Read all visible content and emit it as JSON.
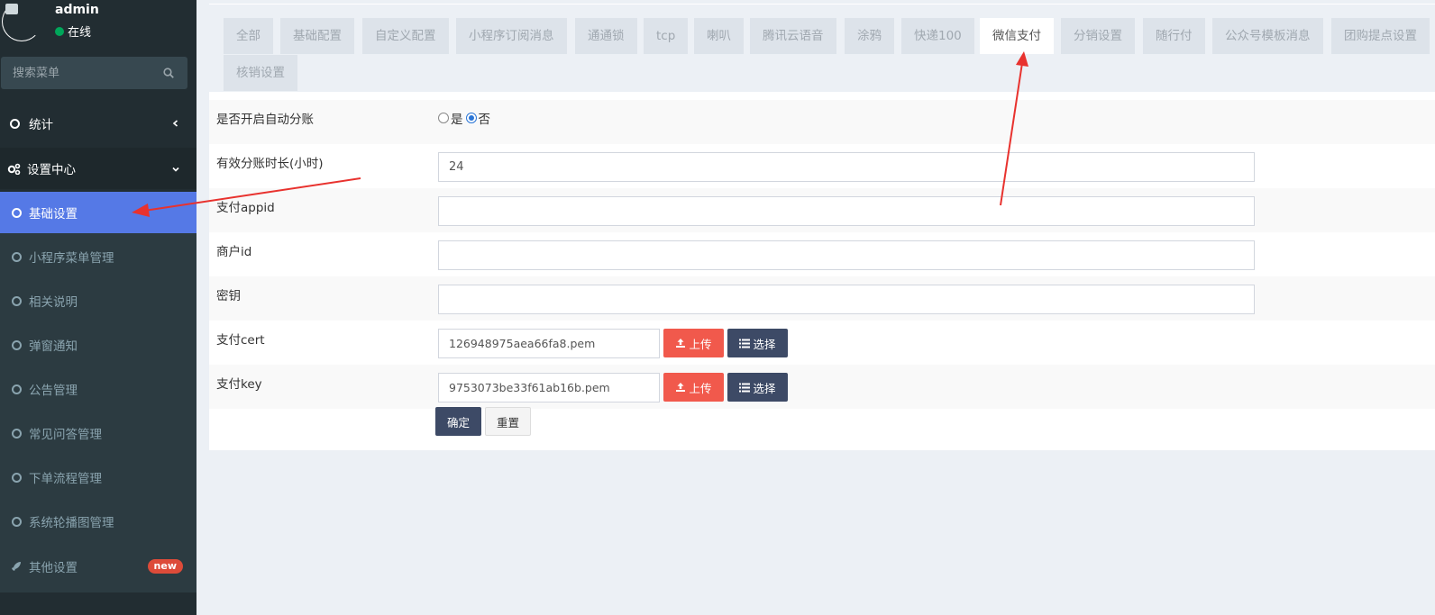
{
  "user": {
    "name": "admin",
    "status": "在线"
  },
  "search": {
    "placeholder": "搜索菜单"
  },
  "menu": {
    "stat": "统计",
    "settings": "设置中心",
    "sub_items": [
      "基础设置",
      "小程序菜单管理",
      "相关说明",
      "弹窗通知",
      "公告管理",
      "常见问答管理",
      "下单流程管理",
      "系统轮播图管理"
    ],
    "other": "其他设置",
    "other_badge": "new"
  },
  "tabs": [
    "全部",
    "基础配置",
    "自定义配置",
    "小程序订阅消息",
    "通通锁",
    "tcp",
    "喇叭",
    "腾讯云语音",
    "涂鸦",
    "快递100",
    "微信支付",
    "分销设置",
    "随行付",
    "公众号模板消息",
    "团购提点设置",
    "核销设置"
  ],
  "active_tab": "微信支付",
  "form": {
    "auto_split": {
      "label": "是否开启自动分账",
      "option_yes": "是",
      "option_no": "否",
      "selected": "否"
    },
    "split_hours": {
      "label": "有效分账时长(小时)",
      "value": "24"
    },
    "appid": {
      "label": "支付appid",
      "value": ""
    },
    "merchant_id": {
      "label": "商户id",
      "value": ""
    },
    "secret": {
      "label": "密钥",
      "value": ""
    },
    "cert": {
      "label": "支付cert",
      "value": "126948975aea66fa8.pem"
    },
    "key": {
      "label": "支付key",
      "value": "9753073be33f61ab16b.pem"
    },
    "upload_label": "上传",
    "select_label": "选择",
    "confirm_label": "确定",
    "reset_label": "重置"
  },
  "colors": {
    "sidebar": "#222d32",
    "active": "#5579e6",
    "upload": "#f1594c",
    "dark_button": "#3d4a66",
    "arrow": "#e8322e"
  }
}
